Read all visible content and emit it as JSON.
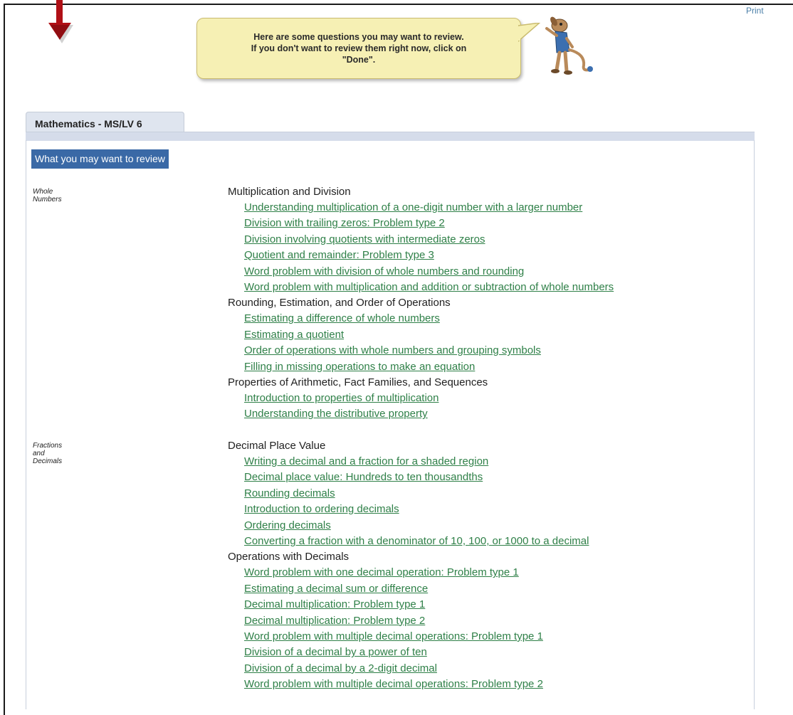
{
  "header": {
    "print_label": "Print",
    "bubble_text": "Here are some questions you may want to review.\nIf you don't want to review them right now, click on\n\"Done\"."
  },
  "tab": {
    "label": "Mathematics - MS/LV 6"
  },
  "review_header": "What you may want to review",
  "colors": {
    "link": "#2f8048",
    "header_bg": "#3a69a6",
    "bubble_bg": "#f6f0b4",
    "arrow": "#b01016"
  },
  "sections": [
    {
      "category": "Whole Numbers",
      "topics": [
        {
          "title": "Multiplication and Division",
          "skills": [
            "Understanding multiplication of a one-digit number with a larger number",
            "Division with trailing zeros: Problem type 2",
            "Division involving quotients with intermediate zeros",
            "Quotient and remainder: Problem type 3",
            "Word problem with division of whole numbers and rounding",
            "Word problem with multiplication and addition or subtraction of whole numbers"
          ]
        },
        {
          "title": "Rounding, Estimation, and Order of Operations",
          "skills": [
            "Estimating a difference of whole numbers",
            "Estimating a quotient",
            "Order of operations with whole numbers and grouping symbols",
            "Filling in missing operations to make an equation"
          ]
        },
        {
          "title": "Properties of Arithmetic, Fact Families, and Sequences",
          "skills": [
            "Introduction to properties of multiplication",
            "Understanding the distributive property"
          ]
        }
      ]
    },
    {
      "category": "Fractions and Decimals",
      "topics": [
        {
          "title": "Decimal Place Value",
          "skills": [
            "Writing a decimal and a fraction for a shaded region",
            "Decimal place value: Hundreds to ten thousandths",
            "Rounding decimals",
            "Introduction to ordering decimals",
            "Ordering decimals",
            "Converting a fraction with a denominator of 10, 100, or 1000 to a decimal"
          ]
        },
        {
          "title": "Operations with Decimals",
          "skills": [
            "Word problem with one decimal operation: Problem type 1",
            "Estimating a decimal sum or difference",
            "Decimal multiplication: Problem type 1",
            "Decimal multiplication: Problem type 2",
            "Word problem with multiple decimal operations: Problem type 1",
            "Division of a decimal by a power of ten",
            "Division of a decimal by a 2-digit decimal",
            "Word problem with multiple decimal operations: Problem type 2"
          ]
        }
      ]
    }
  ]
}
